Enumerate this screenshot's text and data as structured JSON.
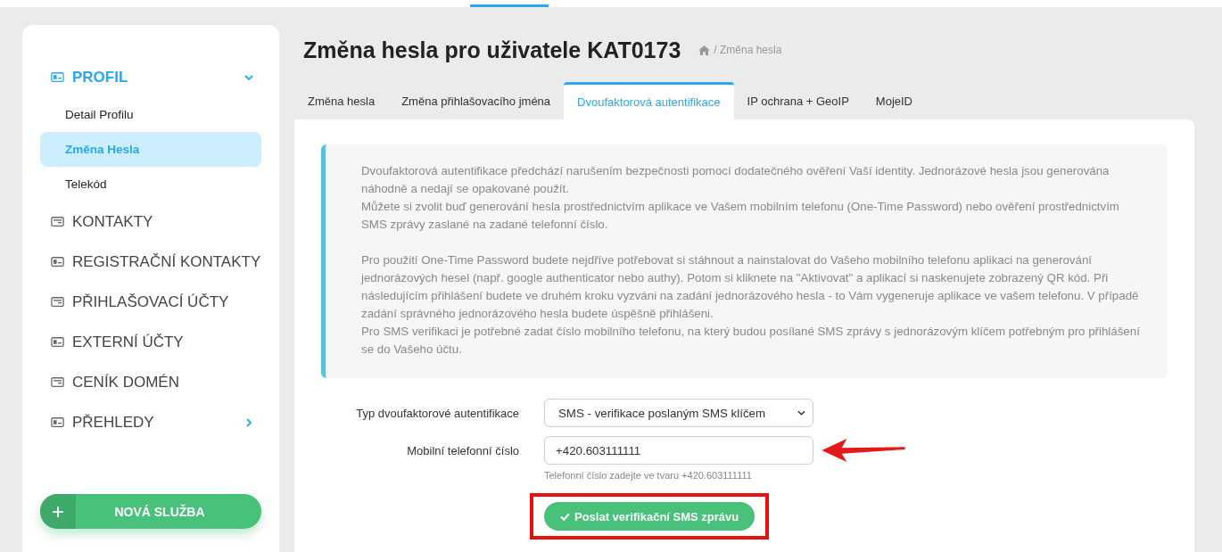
{
  "sidebar": {
    "items": [
      {
        "label": "PROFIL",
        "selected": true,
        "expanded": true,
        "children": [
          {
            "label": "Detail Profilu",
            "selected": false
          },
          {
            "label": "Změna Hesla",
            "selected": true
          },
          {
            "label": "Telekód",
            "selected": false
          }
        ]
      },
      {
        "label": "KONTAKTY",
        "selected": false
      },
      {
        "label": "REGISTRAČNÍ KONTAKTY",
        "selected": false
      },
      {
        "label": "PŘIHLAŠOVACÍ ÚČTY",
        "selected": false
      },
      {
        "label": "EXTERNÍ ÚČTY",
        "selected": false
      },
      {
        "label": "CENÍK DOMÉN",
        "selected": false
      },
      {
        "label": "PŘEHLEDY",
        "selected": false,
        "expanded": false
      }
    ],
    "new_service_button": {
      "icon": "+",
      "label": "NOVÁ SLUŽBA"
    }
  },
  "page": {
    "title": "Změna hesla pro uživatele KAT0173",
    "breadcrumb": "/ Změna hesla"
  },
  "tabs": [
    {
      "label": "Změna hesla",
      "selected": false
    },
    {
      "label": "Změna přihlašovacího jména",
      "selected": false
    },
    {
      "label": "Dvoufaktorová autentifikace",
      "selected": true
    },
    {
      "label": "IP ochrana + GeoIP",
      "selected": false
    },
    {
      "label": "MojeID",
      "selected": false
    }
  ],
  "info": {
    "groups": [
      [
        "Dvoufaktorová autentifikace předchází narušením bezpečnosti pomocí dodatečného ověření Vaší identity. Jednorázové hesla jsou generována náhodně a nedají se opakované použít.",
        "Můžete si zvolit buď generování hesla prostřednictvím aplikace ve Vašem mobilním telefonu (One-Time Password) nebo ověření prostřednictvím SMS zprávy zaslané na zadané telefonní číslo."
      ],
      [
        "Pro použití One-Time Password budete nejdříve potřebovat si stáhnout a nainstalovat do Vašeho mobilního telefonu aplikaci na generování jednorázových hesel (např. google authenticator nebo authy). Potom si kliknete na \"Aktivovat\" a aplikací si naskenujete zobrazený QR kód. Při následujícím přihlášení budete ve druhém kroku vyzváni na zadání jednorázového hesla - to Vám vygeneruje aplikace ve vašem telefonu. V případě zadání správného jednorázového hesla budete úspěšně přihlášeni.",
        "Pro SMS verifikaci je potřebné zadat číslo mobilního telefonu, na který budou posílané SMS zprávy s jednorázovým klíčem potřebným pro přihlášení se do Vašeho účtu."
      ]
    ]
  },
  "form": {
    "type": {
      "label": "Typ dvoufaktorové autentifikace",
      "value": "SMS - verifikace poslaným SMS klíčem"
    },
    "phone": {
      "label": "Mobilní telefonní číslo",
      "value": "+420.603111111",
      "help": "Telefonní číslo zadejte ve tvaru +420.603111111",
      "arrow_marked": true
    },
    "send_button": {
      "label": "Poslat verifikační SMS zprávu",
      "framed": true
    }
  }
}
